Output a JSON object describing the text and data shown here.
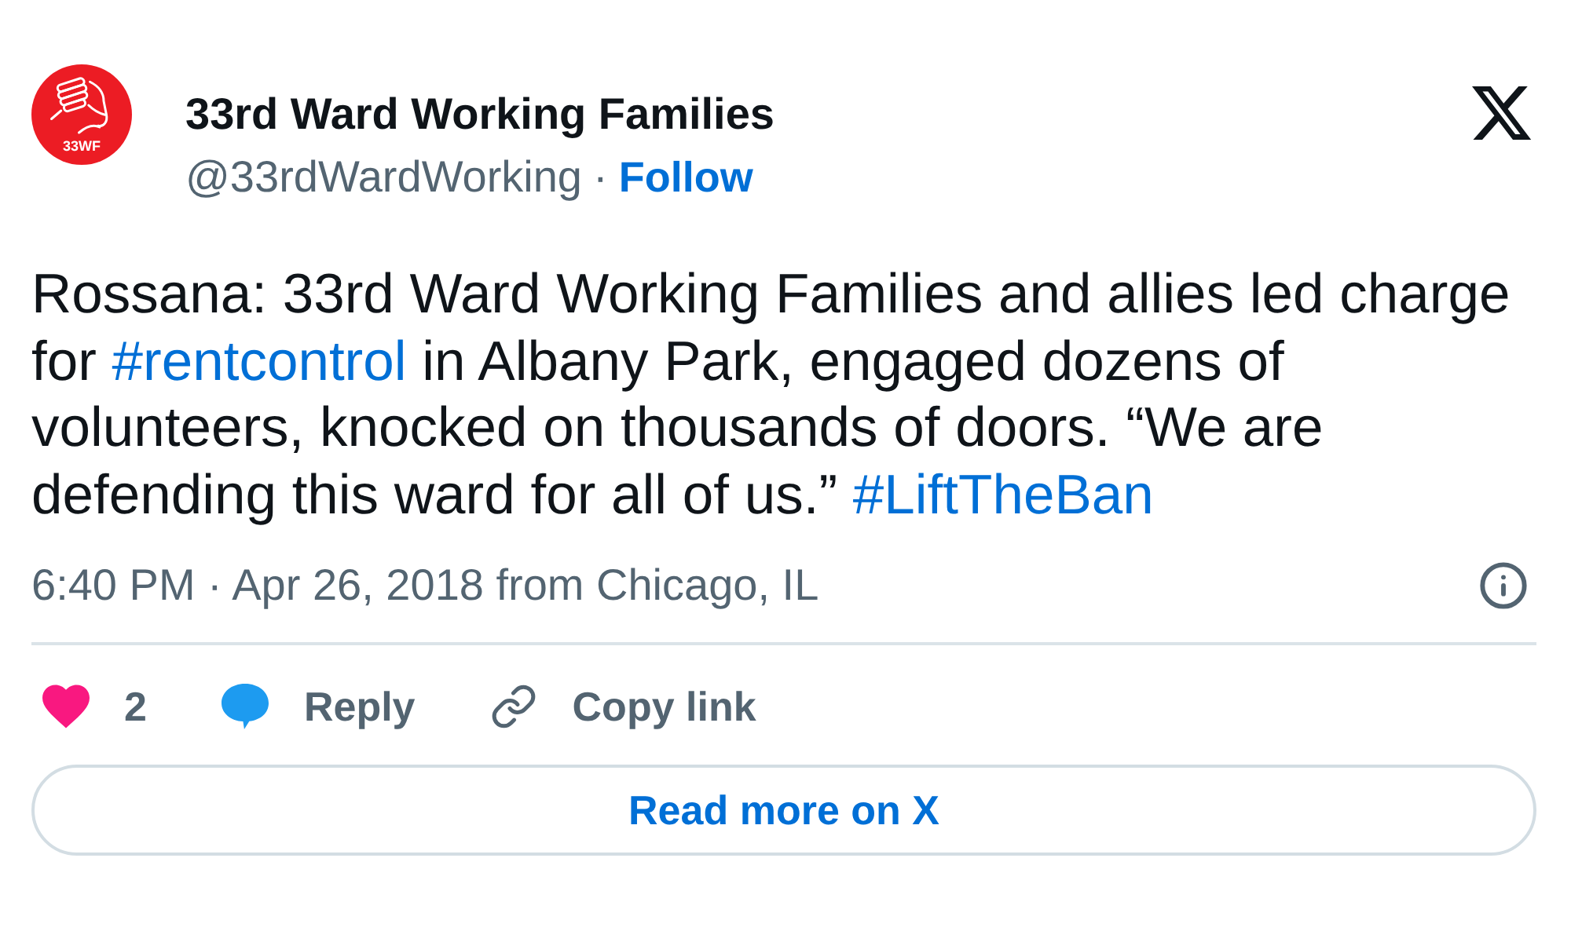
{
  "account": {
    "avatar_text": "33WF",
    "name": "33rd Ward Working Families",
    "handle": "@33rdWardWorking",
    "separator": "·",
    "follow": "Follow"
  },
  "tweet": {
    "segments": [
      {
        "kind": "text",
        "text": "Rossana: 33rd Ward Working Families and allies led charge for "
      },
      {
        "kind": "hashtag",
        "text": "#rentcontrol"
      },
      {
        "kind": "text",
        "text": " in Albany Park, engaged dozens of volunteers, knocked on thousands of doors. “We are defending this ward for all of us.” "
      },
      {
        "kind": "hashtag",
        "text": "#LiftTheBan"
      }
    ]
  },
  "meta": {
    "timestamp": "6:40 PM · Apr 26, 2018 from Chicago, IL"
  },
  "actions": [
    {
      "kind": "like",
      "label": "2"
    },
    {
      "kind": "reply",
      "label": "Reply"
    },
    {
      "kind": "copy",
      "label": "Copy link"
    }
  ],
  "read_more": "Read more on X"
}
